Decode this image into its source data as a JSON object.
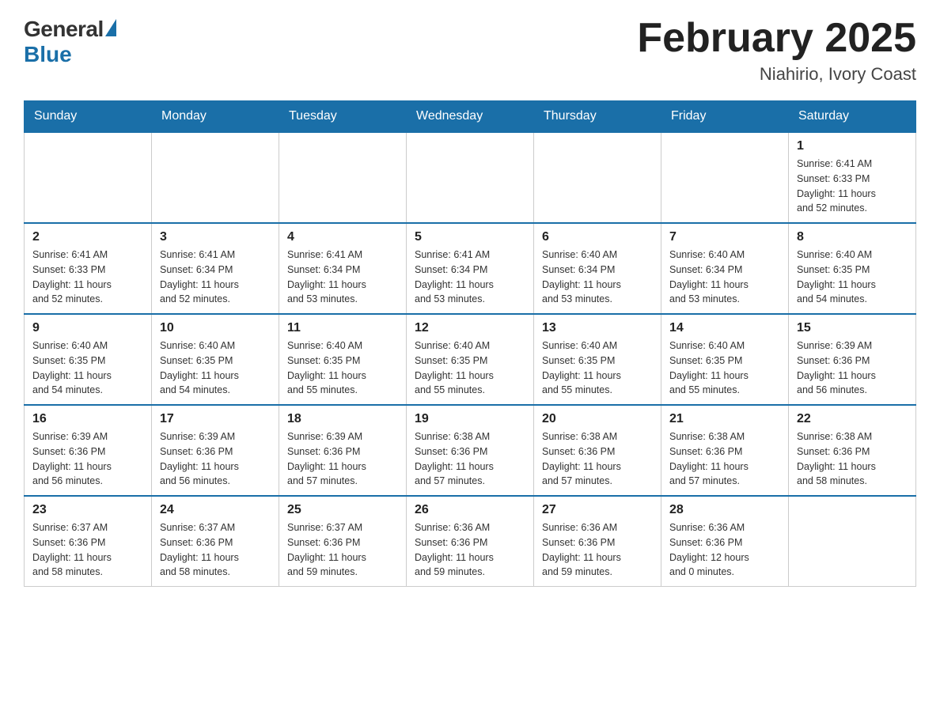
{
  "header": {
    "logo_general": "General",
    "logo_blue": "Blue",
    "month_title": "February 2025",
    "location": "Niahirio, Ivory Coast"
  },
  "weekdays": [
    "Sunday",
    "Monday",
    "Tuesday",
    "Wednesday",
    "Thursday",
    "Friday",
    "Saturday"
  ],
  "weeks": [
    [
      {
        "day": "",
        "info": ""
      },
      {
        "day": "",
        "info": ""
      },
      {
        "day": "",
        "info": ""
      },
      {
        "day": "",
        "info": ""
      },
      {
        "day": "",
        "info": ""
      },
      {
        "day": "",
        "info": ""
      },
      {
        "day": "1",
        "info": "Sunrise: 6:41 AM\nSunset: 6:33 PM\nDaylight: 11 hours\nand 52 minutes."
      }
    ],
    [
      {
        "day": "2",
        "info": "Sunrise: 6:41 AM\nSunset: 6:33 PM\nDaylight: 11 hours\nand 52 minutes."
      },
      {
        "day": "3",
        "info": "Sunrise: 6:41 AM\nSunset: 6:34 PM\nDaylight: 11 hours\nand 52 minutes."
      },
      {
        "day": "4",
        "info": "Sunrise: 6:41 AM\nSunset: 6:34 PM\nDaylight: 11 hours\nand 53 minutes."
      },
      {
        "day": "5",
        "info": "Sunrise: 6:41 AM\nSunset: 6:34 PM\nDaylight: 11 hours\nand 53 minutes."
      },
      {
        "day": "6",
        "info": "Sunrise: 6:40 AM\nSunset: 6:34 PM\nDaylight: 11 hours\nand 53 minutes."
      },
      {
        "day": "7",
        "info": "Sunrise: 6:40 AM\nSunset: 6:34 PM\nDaylight: 11 hours\nand 53 minutes."
      },
      {
        "day": "8",
        "info": "Sunrise: 6:40 AM\nSunset: 6:35 PM\nDaylight: 11 hours\nand 54 minutes."
      }
    ],
    [
      {
        "day": "9",
        "info": "Sunrise: 6:40 AM\nSunset: 6:35 PM\nDaylight: 11 hours\nand 54 minutes."
      },
      {
        "day": "10",
        "info": "Sunrise: 6:40 AM\nSunset: 6:35 PM\nDaylight: 11 hours\nand 54 minutes."
      },
      {
        "day": "11",
        "info": "Sunrise: 6:40 AM\nSunset: 6:35 PM\nDaylight: 11 hours\nand 55 minutes."
      },
      {
        "day": "12",
        "info": "Sunrise: 6:40 AM\nSunset: 6:35 PM\nDaylight: 11 hours\nand 55 minutes."
      },
      {
        "day": "13",
        "info": "Sunrise: 6:40 AM\nSunset: 6:35 PM\nDaylight: 11 hours\nand 55 minutes."
      },
      {
        "day": "14",
        "info": "Sunrise: 6:40 AM\nSunset: 6:35 PM\nDaylight: 11 hours\nand 55 minutes."
      },
      {
        "day": "15",
        "info": "Sunrise: 6:39 AM\nSunset: 6:36 PM\nDaylight: 11 hours\nand 56 minutes."
      }
    ],
    [
      {
        "day": "16",
        "info": "Sunrise: 6:39 AM\nSunset: 6:36 PM\nDaylight: 11 hours\nand 56 minutes."
      },
      {
        "day": "17",
        "info": "Sunrise: 6:39 AM\nSunset: 6:36 PM\nDaylight: 11 hours\nand 56 minutes."
      },
      {
        "day": "18",
        "info": "Sunrise: 6:39 AM\nSunset: 6:36 PM\nDaylight: 11 hours\nand 57 minutes."
      },
      {
        "day": "19",
        "info": "Sunrise: 6:38 AM\nSunset: 6:36 PM\nDaylight: 11 hours\nand 57 minutes."
      },
      {
        "day": "20",
        "info": "Sunrise: 6:38 AM\nSunset: 6:36 PM\nDaylight: 11 hours\nand 57 minutes."
      },
      {
        "day": "21",
        "info": "Sunrise: 6:38 AM\nSunset: 6:36 PM\nDaylight: 11 hours\nand 57 minutes."
      },
      {
        "day": "22",
        "info": "Sunrise: 6:38 AM\nSunset: 6:36 PM\nDaylight: 11 hours\nand 58 minutes."
      }
    ],
    [
      {
        "day": "23",
        "info": "Sunrise: 6:37 AM\nSunset: 6:36 PM\nDaylight: 11 hours\nand 58 minutes."
      },
      {
        "day": "24",
        "info": "Sunrise: 6:37 AM\nSunset: 6:36 PM\nDaylight: 11 hours\nand 58 minutes."
      },
      {
        "day": "25",
        "info": "Sunrise: 6:37 AM\nSunset: 6:36 PM\nDaylight: 11 hours\nand 59 minutes."
      },
      {
        "day": "26",
        "info": "Sunrise: 6:36 AM\nSunset: 6:36 PM\nDaylight: 11 hours\nand 59 minutes."
      },
      {
        "day": "27",
        "info": "Sunrise: 6:36 AM\nSunset: 6:36 PM\nDaylight: 11 hours\nand 59 minutes."
      },
      {
        "day": "28",
        "info": "Sunrise: 6:36 AM\nSunset: 6:36 PM\nDaylight: 12 hours\nand 0 minutes."
      },
      {
        "day": "",
        "info": ""
      }
    ]
  ]
}
